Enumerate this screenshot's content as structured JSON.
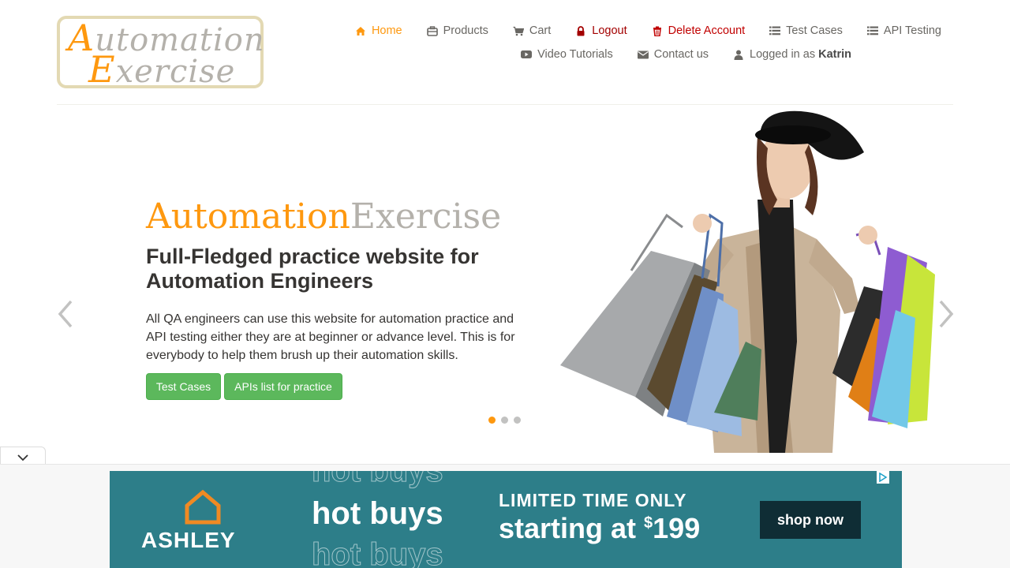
{
  "logo": {
    "line1": "Automation",
    "line2": "Exercise"
  },
  "nav": {
    "row1": [
      {
        "label": "Home",
        "icon": "home-icon"
      },
      {
        "label": "Products",
        "icon": "products-icon"
      },
      {
        "label": "Cart",
        "icon": "cart-icon"
      },
      {
        "label": "Logout",
        "icon": "lock-icon"
      },
      {
        "label": "Delete Account",
        "icon": "trash-icon"
      },
      {
        "label": "Test Cases",
        "icon": "list-icon"
      },
      {
        "label": "API Testing",
        "icon": "list-icon"
      }
    ],
    "row2": [
      {
        "label": "Video Tutorials",
        "icon": "youtube-icon"
      },
      {
        "label": "Contact us",
        "icon": "envelope-icon"
      },
      {
        "label": "Logged in as",
        "icon": "user-icon",
        "username": "Katrin"
      }
    ]
  },
  "slider": {
    "brand_orange": "Automation",
    "brand_grey": "Exercise",
    "headline": "Full-Fledged practice website for Automation Engineers",
    "description": "All QA engineers can use this website for automation practice and API testing either they are at beginner or advance level. This is for everybody to help them brush up their automation skills.",
    "btn_test_cases": "Test Cases",
    "btn_apis": "APIs list for practice",
    "dots_count": 3,
    "active_dot": 0
  },
  "ad": {
    "brand": "ASHLEY",
    "hot_buys": "hot buys",
    "limited": "LIMITED TIME ONLY",
    "price_prefix": "starting at ",
    "price_currency": "$",
    "price_value": "199",
    "cta": "shop now"
  },
  "colors": {
    "accent": "#fe980f",
    "button_green": "#5cb85c",
    "ad_teal": "#2d7e89"
  }
}
